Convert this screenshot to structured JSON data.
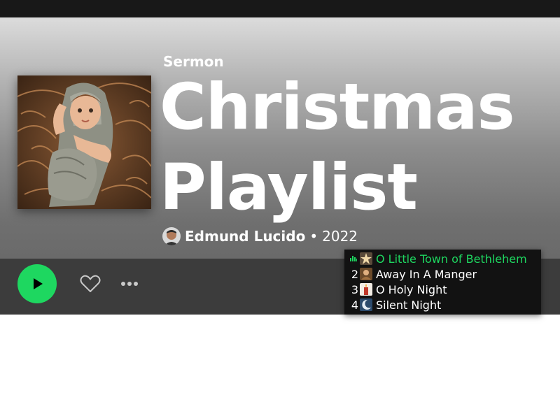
{
  "playlist": {
    "type_label": "Sermon",
    "title": "Christmas Playlist",
    "owner": "Edmund Lucido",
    "separator": "•",
    "year": "2022"
  },
  "colors": {
    "accent": "#1ed760",
    "actionbar": "#3c3c3c",
    "tracklist_bg": "#121212",
    "topbar": "#181818"
  },
  "controls": {
    "play_icon": "play-icon",
    "like_icon": "heart-outline-icon",
    "more_icon": "more-horizontal-icon"
  },
  "tracks": [
    {
      "number": "",
      "playing": true,
      "title": "O Little Town of Bethlehem",
      "thumb": "star-angel-thumb"
    },
    {
      "number": "2",
      "playing": false,
      "title": "Away In A Manger",
      "thumb": "manger-thumb"
    },
    {
      "number": "3",
      "playing": false,
      "title": "O Holy Night",
      "thumb": "candle-thumb"
    },
    {
      "number": "4",
      "playing": false,
      "title": "Silent Night",
      "thumb": "moon-thumb"
    }
  ]
}
